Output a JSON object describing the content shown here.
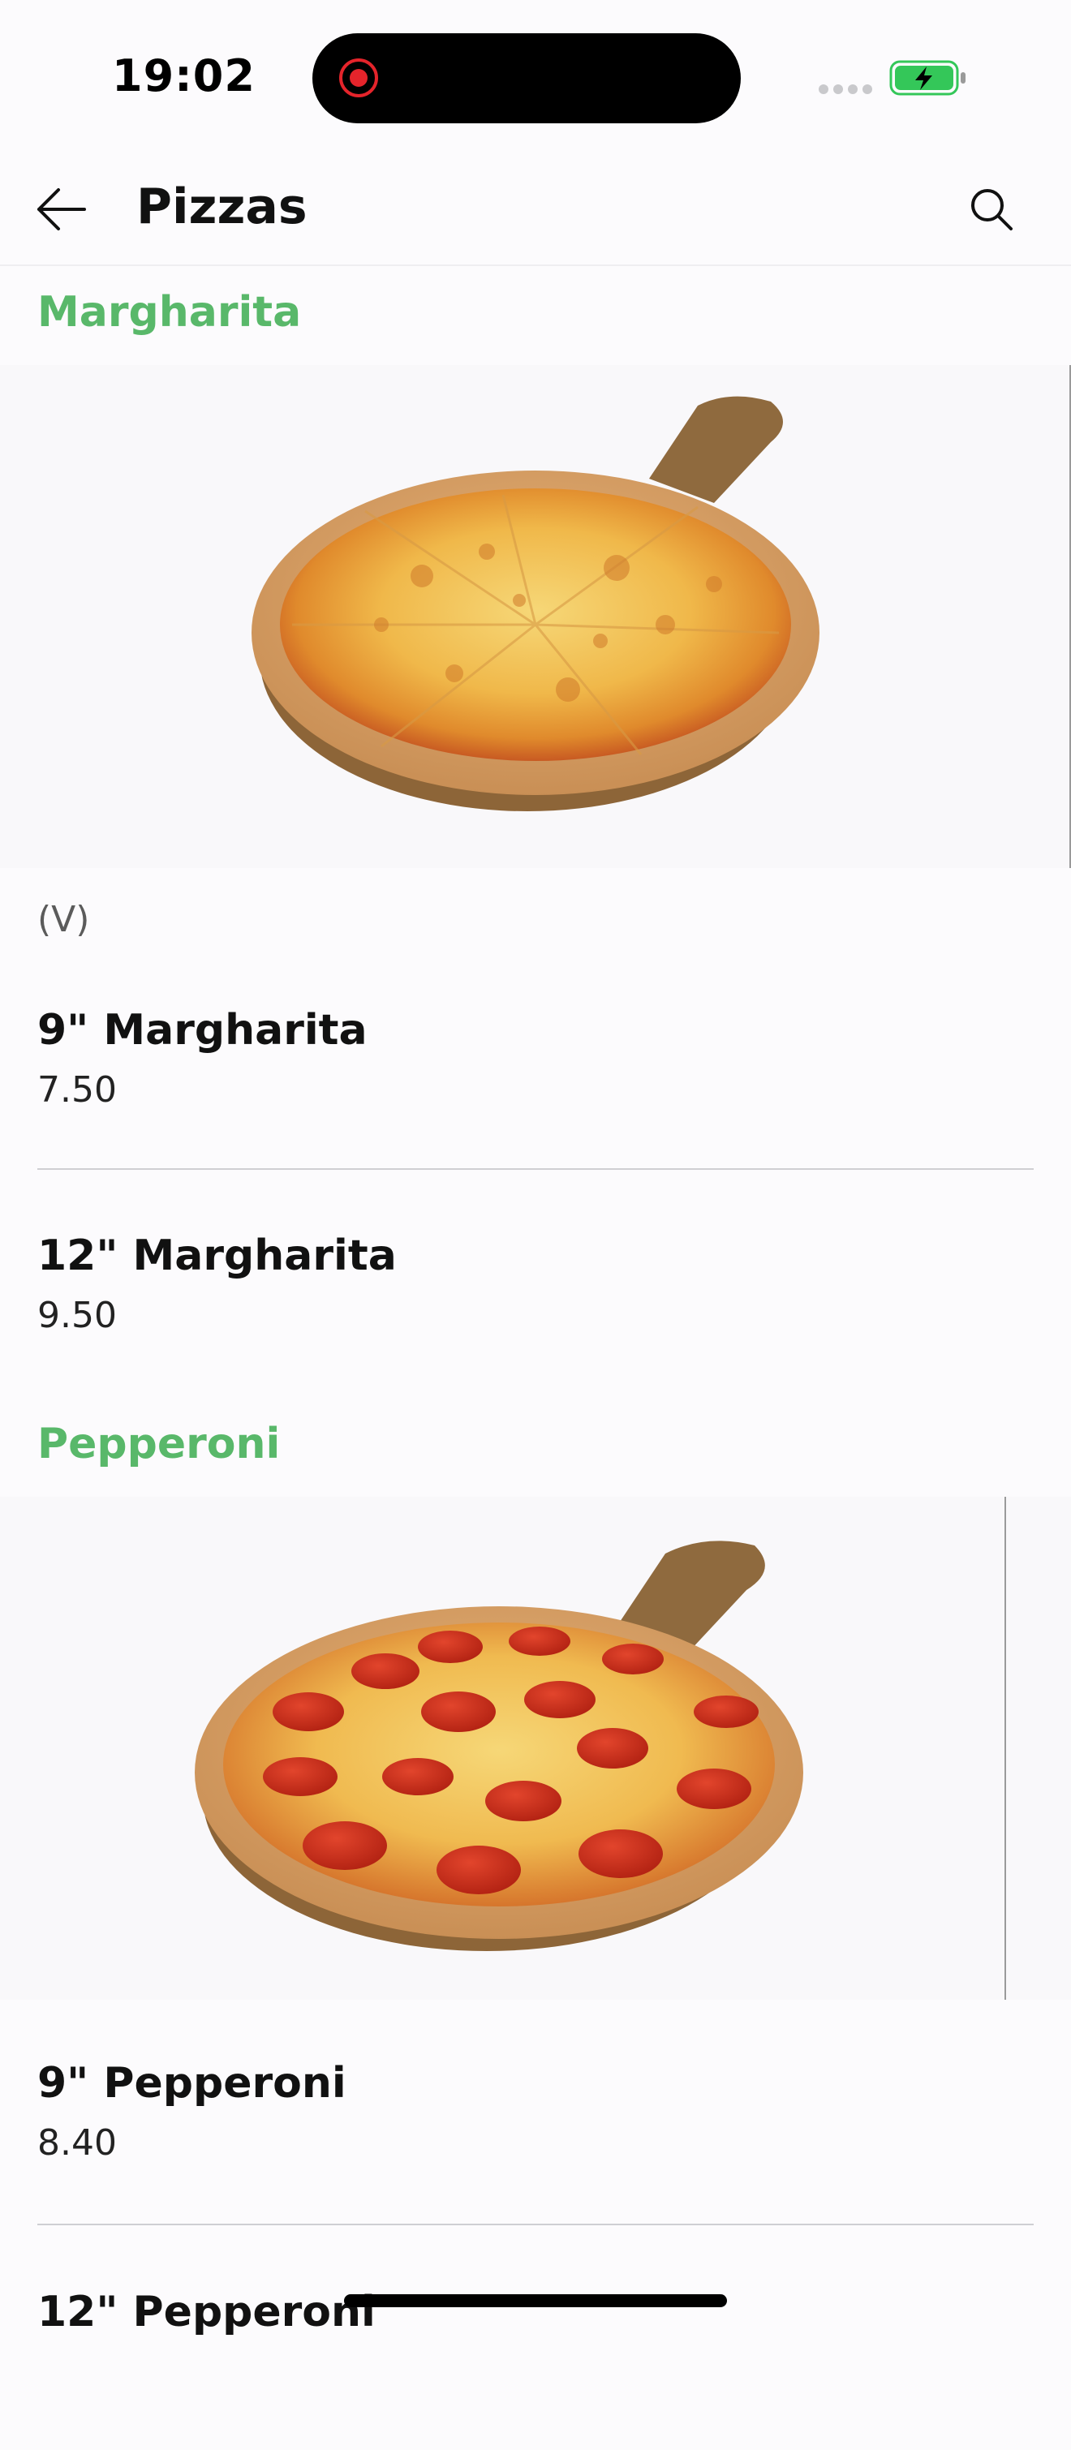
{
  "status_bar": {
    "time": "19:02",
    "battery_state": "charging",
    "battery_color": "#34c759"
  },
  "header": {
    "title": "Pizzas",
    "back_icon": "arrow-left-icon",
    "search_icon": "search-icon"
  },
  "sections": [
    {
      "title": "Margharita",
      "image": "margherita-pizza-photo",
      "dietary_tag": "(V)",
      "items": [
        {
          "name": "9\" Margharita",
          "price": "7.50"
        },
        {
          "name": "12\" Margharita",
          "price": "9.50"
        }
      ]
    },
    {
      "title": "Pepperoni",
      "image": "pepperoni-pizza-photo",
      "items": [
        {
          "name": "9\" Pepperoni",
          "price": "8.40"
        },
        {
          "name": "12\" Pepperoni",
          "price": ""
        }
      ]
    }
  ],
  "theme": {
    "accent": "#59b86a",
    "record_indicator": "#e5242b"
  }
}
